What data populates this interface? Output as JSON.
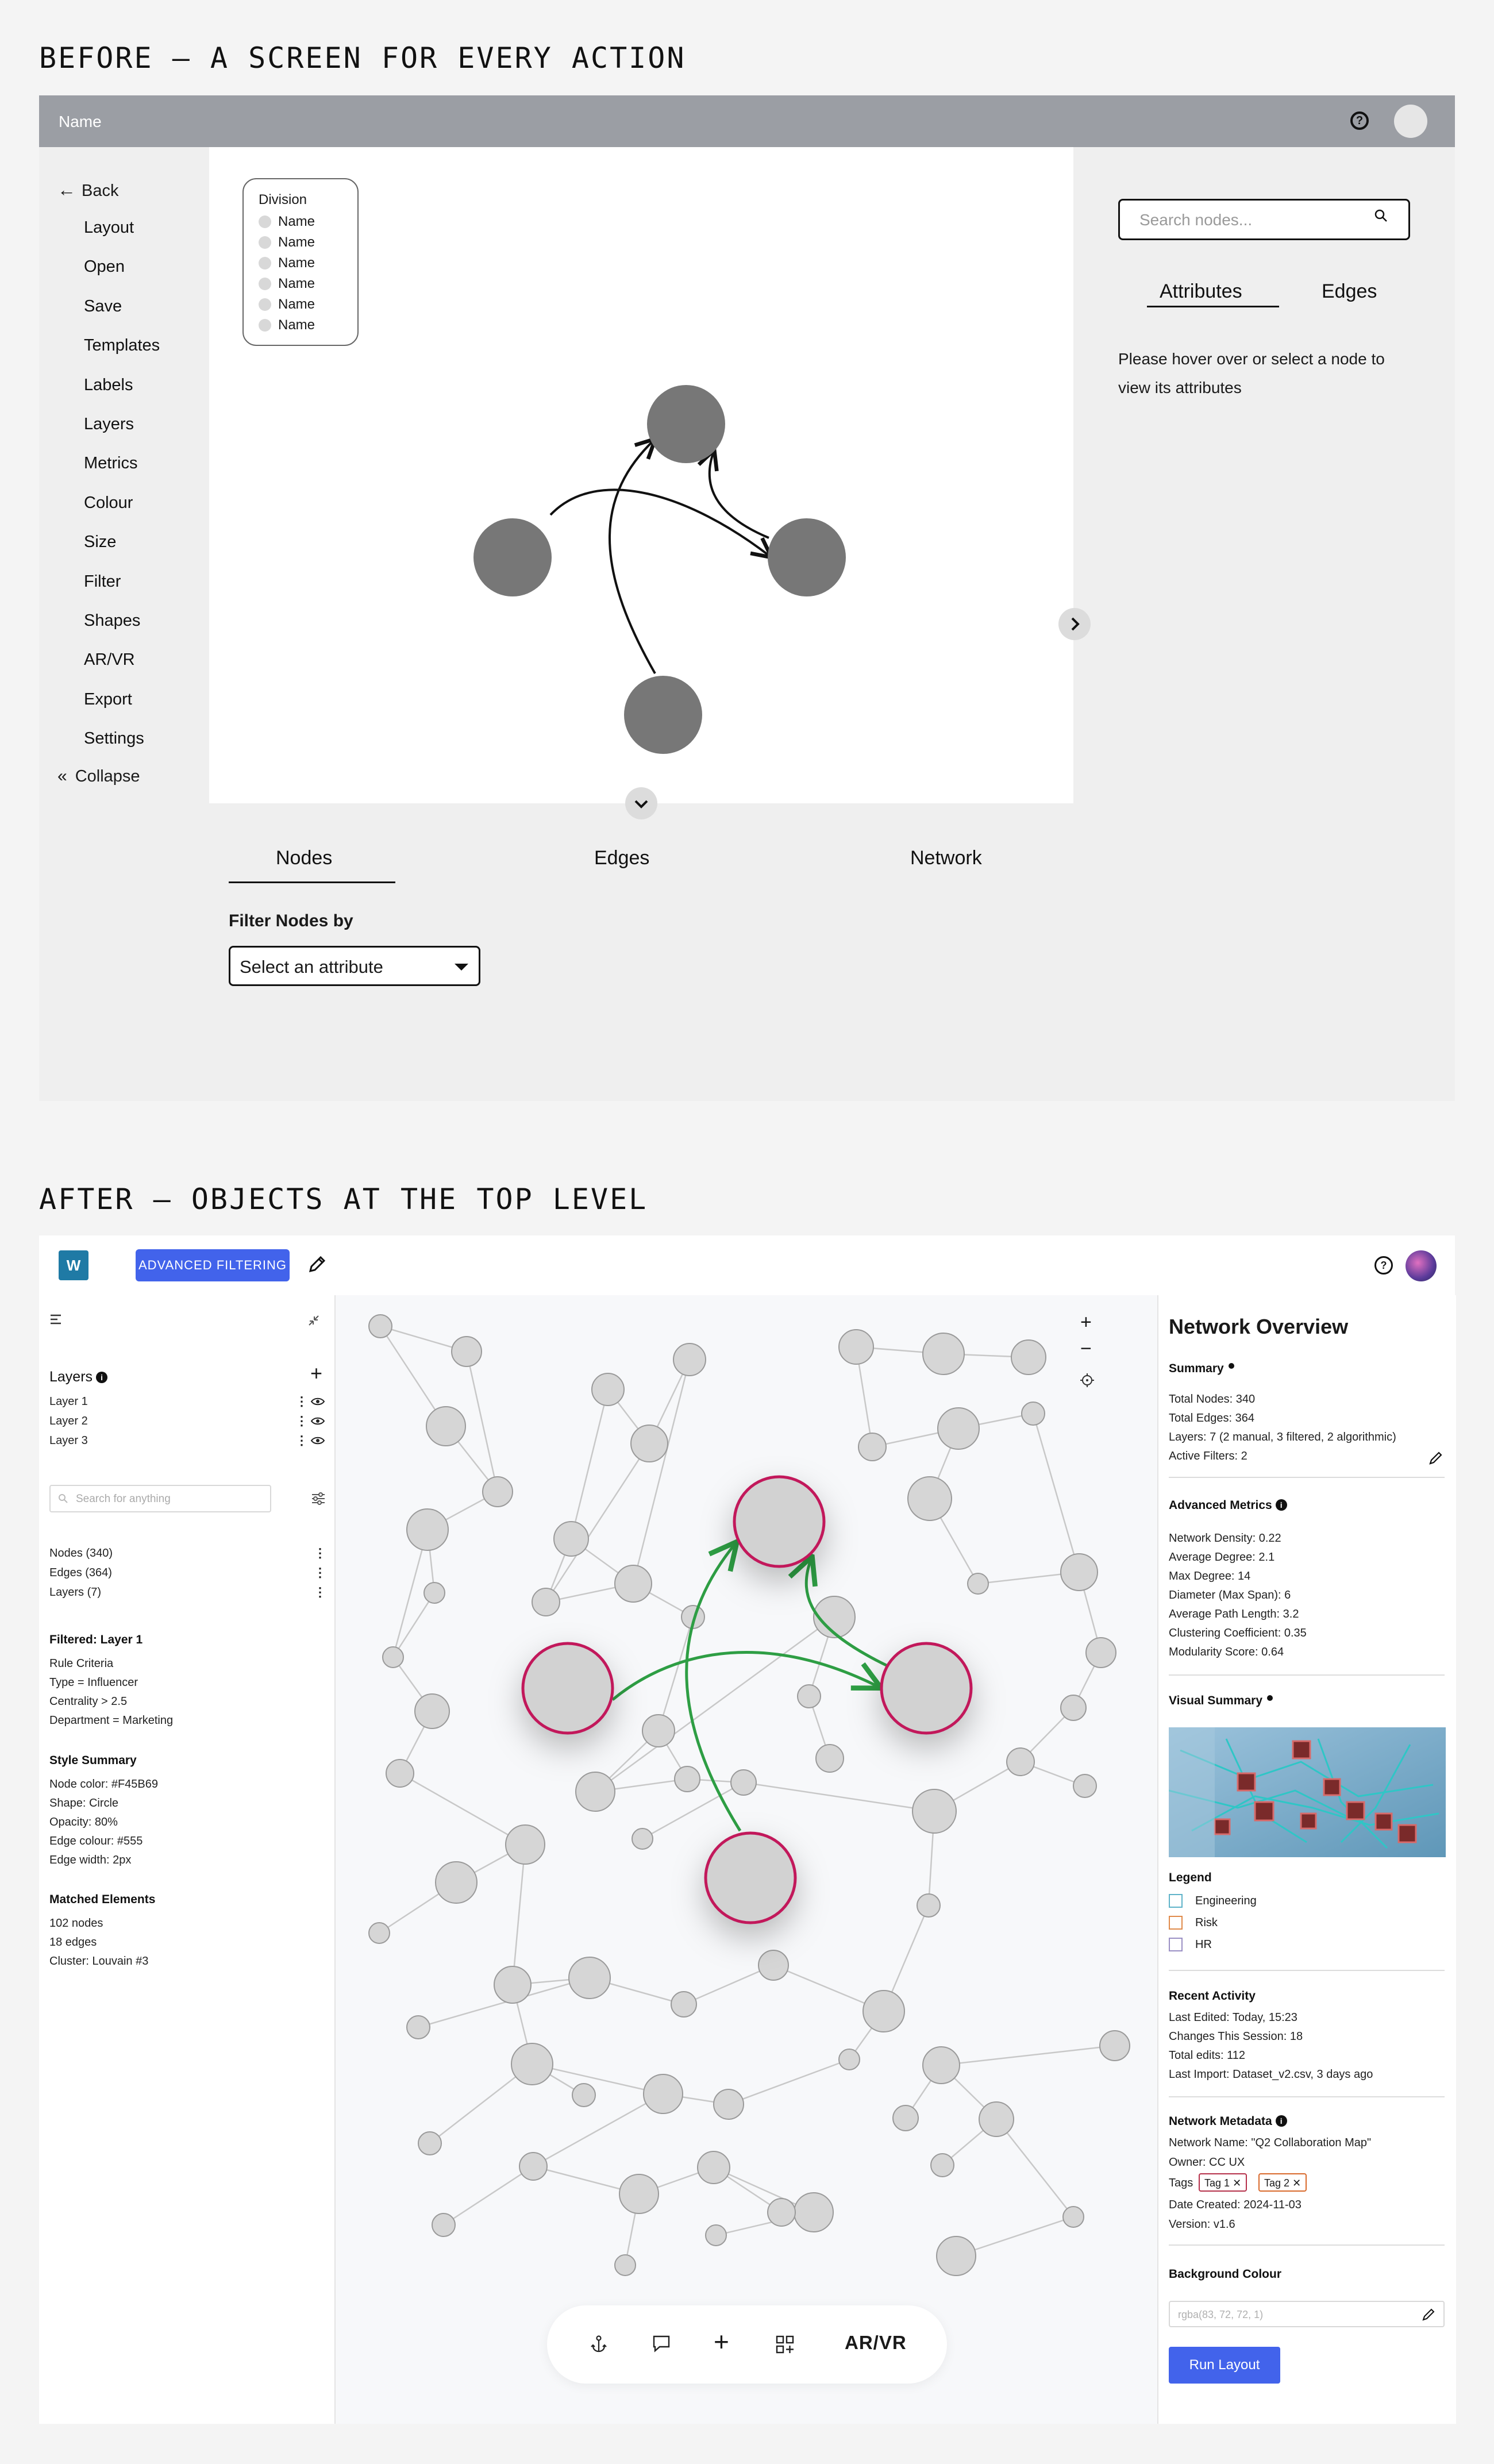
{
  "before": {
    "title": "BEFORE — A SCREEN FOR EVERY ACTION",
    "topbar": {
      "name": "Name",
      "help_glyph": "?"
    },
    "menu": {
      "back": "Back",
      "items": [
        "Layout",
        "Open",
        "Save",
        "Templates",
        "Labels",
        "Layers",
        "Metrics",
        "Colour",
        "Size",
        "Filter",
        "Shapes",
        "AR/VR",
        "Export",
        "Settings"
      ],
      "collapse": "Collapse"
    },
    "legend": {
      "title": "Division",
      "items": [
        "Name",
        "Name",
        "Name",
        "Name",
        "Name",
        "Name"
      ]
    },
    "search": {
      "placeholder": "Search nodes..."
    },
    "right_tabs": [
      "Attributes",
      "Edges"
    ],
    "hint": [
      "Please hover over or select a node to",
      "view its attributes"
    ],
    "bottom_tabs": [
      "Nodes",
      "Edges",
      "Network"
    ],
    "filter": {
      "label": "Filter Nodes by",
      "select_value": "Select an attribute"
    }
  },
  "after": {
    "title": "AFTER — OBJECTS AT THE TOP LEVEL",
    "topbar": {
      "logo_letter": "W",
      "advanced_filtering": "ADVANCED FILTERING",
      "help_glyph": "?"
    },
    "left": {
      "layers_title": "Layers",
      "layers": [
        "Layer 1",
        "Layer 2",
        "Layer 3"
      ],
      "search_placeholder": "Search for anything",
      "counts": [
        "Nodes (340)",
        "Edges (364)",
        "Layers (7)"
      ],
      "filtered_title": "Filtered: Layer 1",
      "rule_criteria": [
        "Rule Criteria",
        "Type = Influencer",
        "Centrality > 2.5",
        "Department = Marketing"
      ],
      "style_title": "Style Summary",
      "style": [
        "Node color: #F45B69",
        "Shape: Circle",
        "Opacity: 80%",
        "Edge colour: #555",
        "Edge width: 2px"
      ],
      "matched_title": "Matched Elements",
      "matched": [
        "102 nodes",
        "18 edges",
        "Cluster: Louvain #3"
      ]
    },
    "canvas": {
      "zoom_in": "+",
      "zoom_out": "−",
      "toolbar_label": "AR/VR"
    },
    "right": {
      "title": "Network Overview",
      "summary_title": "Summary",
      "summary": [
        "Total Nodes: 340",
        "Total Edges: 364",
        "Layers: 7 (2 manual, 3 filtered, 2 algorithmic)",
        "Active Filters: 2"
      ],
      "metrics_title": "Advanced Metrics",
      "metrics": [
        "Network Density: 0.22",
        "Average Degree: 2.1",
        "Max Degree: 14",
        "Diameter (Max Span): 6",
        "Average Path Length: 3.2",
        "Clustering Coefficient: 0.35",
        "Modularity Score: 0.64"
      ],
      "visual_title": "Visual Summary",
      "legend_title": "Legend",
      "legend": [
        {
          "label": "Engineering",
          "color": "#5fb3c9"
        },
        {
          "label": "Risk",
          "color": "#e08a4a"
        },
        {
          "label": "HR",
          "color": "#9a8fc4"
        }
      ],
      "activity_title": "Recent Activity",
      "activity": [
        "Last Edited: Today, 15:23",
        "Changes This Session: 18",
        "Total edits: 112",
        "Last Import: Dataset_v2.csv, 3 days ago"
      ],
      "metadata_title": "Network Metadata",
      "metadata": [
        "Network Name: \"Q2 Collaboration Map\"",
        "Owner: CC UX"
      ],
      "tags_label": "Tags",
      "tags": [
        "Tag 1",
        "Tag 2"
      ],
      "metadata_more": [
        "Date Created: 2024-11-03",
        "Version: v1.6"
      ],
      "bg_title": "Background Colour",
      "bg_placeholder": "rgba(83, 72, 72, 1)",
      "run_layout": "Run Layout"
    },
    "colors": {
      "accent": "#4263eb",
      "highlight_node": "#c2185b",
      "edge_green": "#2e9e44"
    }
  }
}
